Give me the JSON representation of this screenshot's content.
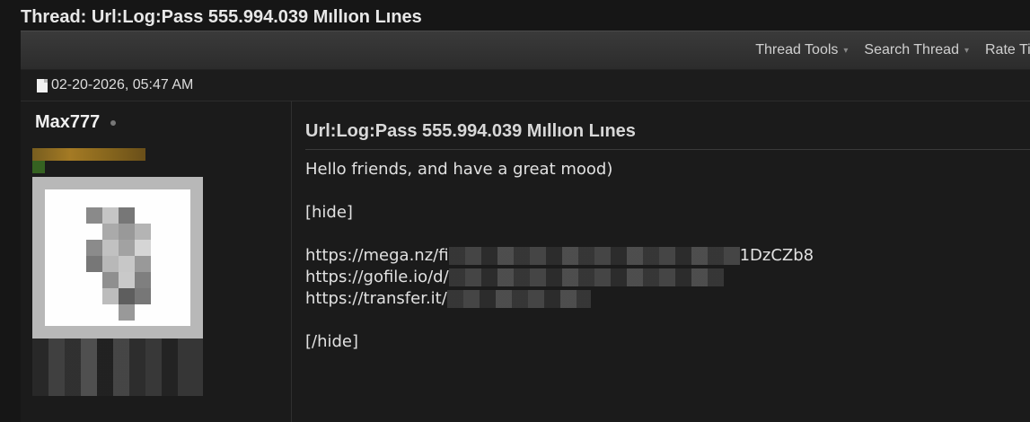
{
  "thread": {
    "title": "Thread: Url:Log:Pass 555.994.039 Mıllıon Lınes"
  },
  "toolbar": {
    "items": [
      {
        "label": "Thread Tools",
        "caret": "▾"
      },
      {
        "label": "Search Thread",
        "caret": "▾"
      },
      {
        "label": "Rate Ti",
        "caret": ""
      }
    ]
  },
  "post": {
    "date": "02-20-2026, 05:47 AM",
    "author": "Max777",
    "title": "Url:Log:Pass 555.994.039 Mıllıon Lınes",
    "greeting": "Hello friends, and have a great mood)",
    "hide_open": "[hide]",
    "link1_prefix": "https://mega.nz/fi",
    "link1_suffix": "1DzCZb8",
    "link2_prefix": "https://gofile.io/d/",
    "link3_prefix": "https://transfer.it/",
    "hide_close": "[/hide]"
  }
}
